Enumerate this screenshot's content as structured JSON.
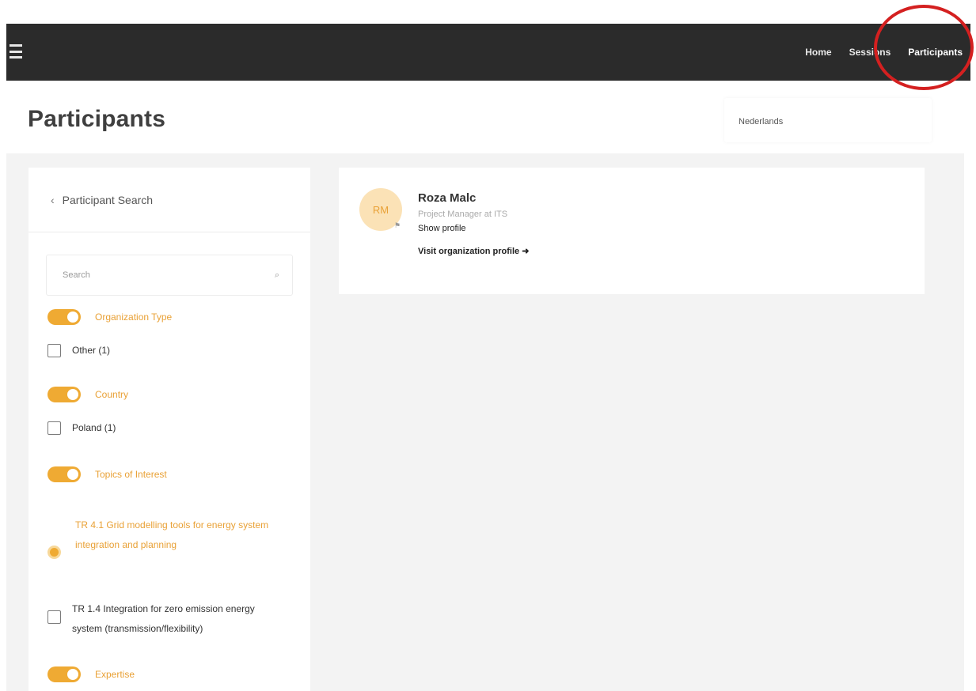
{
  "nav": {
    "items": [
      "Home",
      "Sessions",
      "Participants"
    ],
    "active_index": 2
  },
  "page": {
    "title": "Participants",
    "language": "Nederlands"
  },
  "sidebar": {
    "back_label": "Participant Search",
    "search_placeholder": "Search",
    "filters": [
      {
        "type": "toggle",
        "label": "Organization Type"
      },
      {
        "type": "checkbox",
        "label": "Other (1)"
      },
      {
        "type": "toggle",
        "label": "Country"
      },
      {
        "type": "checkbox",
        "label": "Poland (1)"
      },
      {
        "type": "toggle",
        "label": "Topics of Interest"
      },
      {
        "type": "radio",
        "label": "TR 4.1 Grid modelling tools for energy system integration and planning"
      },
      {
        "type": "checkbox",
        "label": "TR 1.4 Integration for zero emission energy system (transmission/flexibility)"
      },
      {
        "type": "toggle",
        "label": "Expertise"
      }
    ]
  },
  "participant": {
    "initials": "RM",
    "name": "Roza Malc",
    "role": "Project Manager at ITS",
    "profile_link": "Show profile",
    "org_link": "Visit organization profile",
    "org_link_icon": "arrow-right-icon"
  },
  "colors": {
    "accent": "#efaa33",
    "topbar": "#2b2b2b",
    "highlight_ring": "#d42020"
  }
}
